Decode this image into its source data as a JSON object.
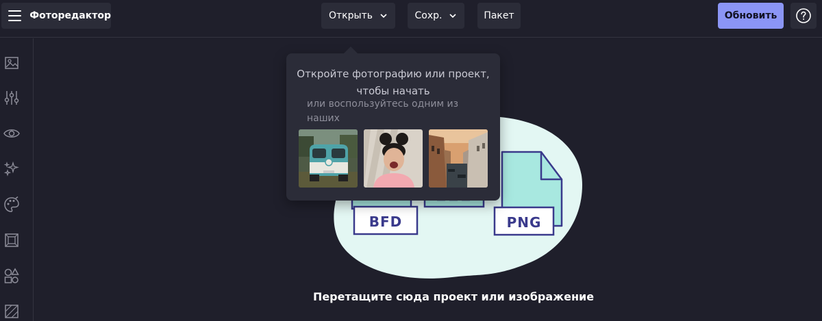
{
  "app": {
    "title": "Фоторедактор"
  },
  "toolbar": {
    "open_label": "Открыть",
    "save_label": "Сохр.",
    "batch_label": "Пакет",
    "update_label": "Обновить",
    "help_icon": "help-circle-icon"
  },
  "sidebar": {
    "icons": [
      "image-icon",
      "adjust-sliders-icon",
      "eye-icon",
      "effects-sparkle-icon",
      "palette-icon",
      "frame-icon",
      "shapes-icon",
      "texture-icon"
    ]
  },
  "popover": {
    "title": "Откройте фотографию или проект, чтобы начать",
    "subtitle": "или воспользуйтесь одним из наших",
    "samples": [
      "sample-van-photo",
      "sample-woman-photo",
      "sample-canal-photo"
    ]
  },
  "dropzone": {
    "text": "Перетащите сюда проект или изображение",
    "file_types": [
      "BFD",
      "PNG"
    ]
  },
  "colors": {
    "background": "#1f1f2b",
    "panel": "#2b2c38",
    "accent": "#8b95f5",
    "blob": "#e3f7f3",
    "file_fill": "#a8e8e0",
    "file_stroke": "#3a3a8c"
  }
}
